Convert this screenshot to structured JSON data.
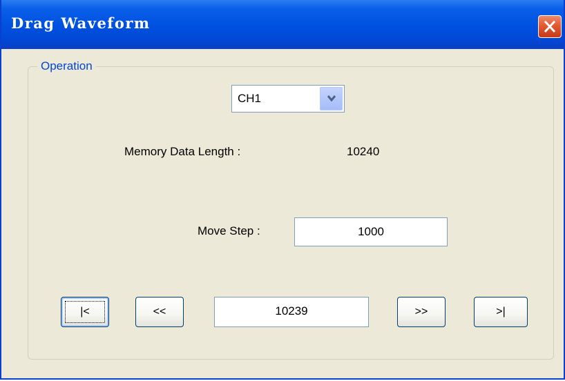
{
  "window": {
    "title": "Drag Waveform"
  },
  "group": {
    "label": "Operation"
  },
  "channel_select": {
    "value": "CH1"
  },
  "memory": {
    "label": "Memory Data Length :",
    "value": "10240"
  },
  "move_step": {
    "label": "Move Step :",
    "value": "1000"
  },
  "navigation": {
    "first_label": "|<",
    "prev_label": "<<",
    "position_value": "10239",
    "next_label": ">>",
    "last_label": ">|"
  },
  "icons": {
    "close": "close-icon",
    "dropdown": "chevron-down-icon"
  },
  "colors": {
    "titlebar": "#0052e0",
    "close_button": "#e25a32",
    "group_label": "#0046d5",
    "background": "#ece9d8"
  }
}
